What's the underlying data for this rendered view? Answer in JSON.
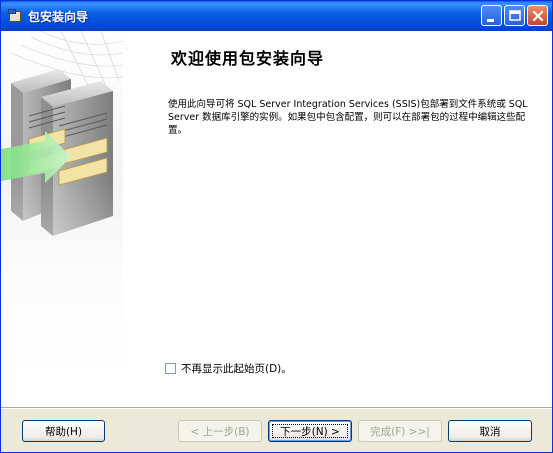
{
  "window": {
    "title": "包安装向导"
  },
  "page": {
    "heading": "欢迎使用包安装向导",
    "intro": "使用此向导可将 SQL Server Integration Services (SSIS)包部署到文件系统或 SQL Server 数据库引擎的实例。如果包中包含配置，则可以在部署包的过程中编辑这些配置。",
    "dont_show_again_label": "不再显示此起始页(D)。",
    "dont_show_again_checked": false
  },
  "buttons": {
    "help": "帮助(H)",
    "back": "< 上一步(B)",
    "next": "下一步(N) >",
    "finish": "完成(F) >>|",
    "cancel": "取消"
  },
  "icons": {
    "app": "package-installer-icon",
    "minimize": "minimize-icon",
    "maximize": "maximize-icon",
    "close": "close-icon"
  }
}
